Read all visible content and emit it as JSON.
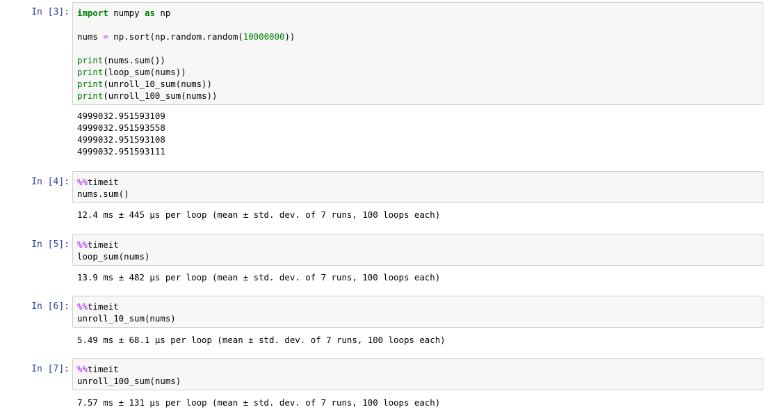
{
  "cells": [
    {
      "prompt": "In [3]:",
      "code": {
        "l1": {
          "kw_import": "import",
          "mod": " numpy ",
          "kw_as": "as",
          "alias": " np"
        },
        "l3": {
          "var": "nums ",
          "eq": "=",
          "call": " np.sort(np.random.random(",
          "num": "10000000",
          "close": "))"
        },
        "l5": {
          "print": "print",
          "rest": "(nums.sum())"
        },
        "l6": {
          "print": "print",
          "rest": "(loop_sum(nums))"
        },
        "l7": {
          "print": "print",
          "rest": "(unroll_10_sum(nums))"
        },
        "l8": {
          "print": "print",
          "rest": "(unroll_100_sum(nums))"
        }
      },
      "output": [
        "4999032.951593109",
        "4999032.951593558",
        "4999032.951593108",
        "4999032.951593111"
      ]
    },
    {
      "prompt": "In [4]:",
      "magic": "%%",
      "magic_word": "timeit",
      "code_line": "nums.sum()",
      "output": "12.4 ms ± 445 µs per loop (mean ± std. dev. of 7 runs, 100 loops each)"
    },
    {
      "prompt": "In [5]:",
      "magic": "%%",
      "magic_word": "timeit",
      "code_line": "loop_sum(nums)",
      "output": "13.9 ms ± 482 µs per loop (mean ± std. dev. of 7 runs, 100 loops each)"
    },
    {
      "prompt": "In [6]:",
      "magic": "%%",
      "magic_word": "timeit",
      "code_line": "unroll_10_sum(nums)",
      "output": "5.49 ms ± 68.1 µs per loop (mean ± std. dev. of 7 runs, 100 loops each)"
    },
    {
      "prompt": "In [7]:",
      "magic": "%%",
      "magic_word": "timeit",
      "code_line": "unroll_100_sum(nums)",
      "output": "7.57 ms ± 131 µs per loop (mean ± std. dev. of 7 runs, 100 loops each)"
    }
  ],
  "colors": {
    "prompt": "#303F9F",
    "keyword": "#008000",
    "magic": "#AA22FF",
    "cell_bg": "#f7f7f7",
    "cell_border": "#cfcfcf"
  }
}
